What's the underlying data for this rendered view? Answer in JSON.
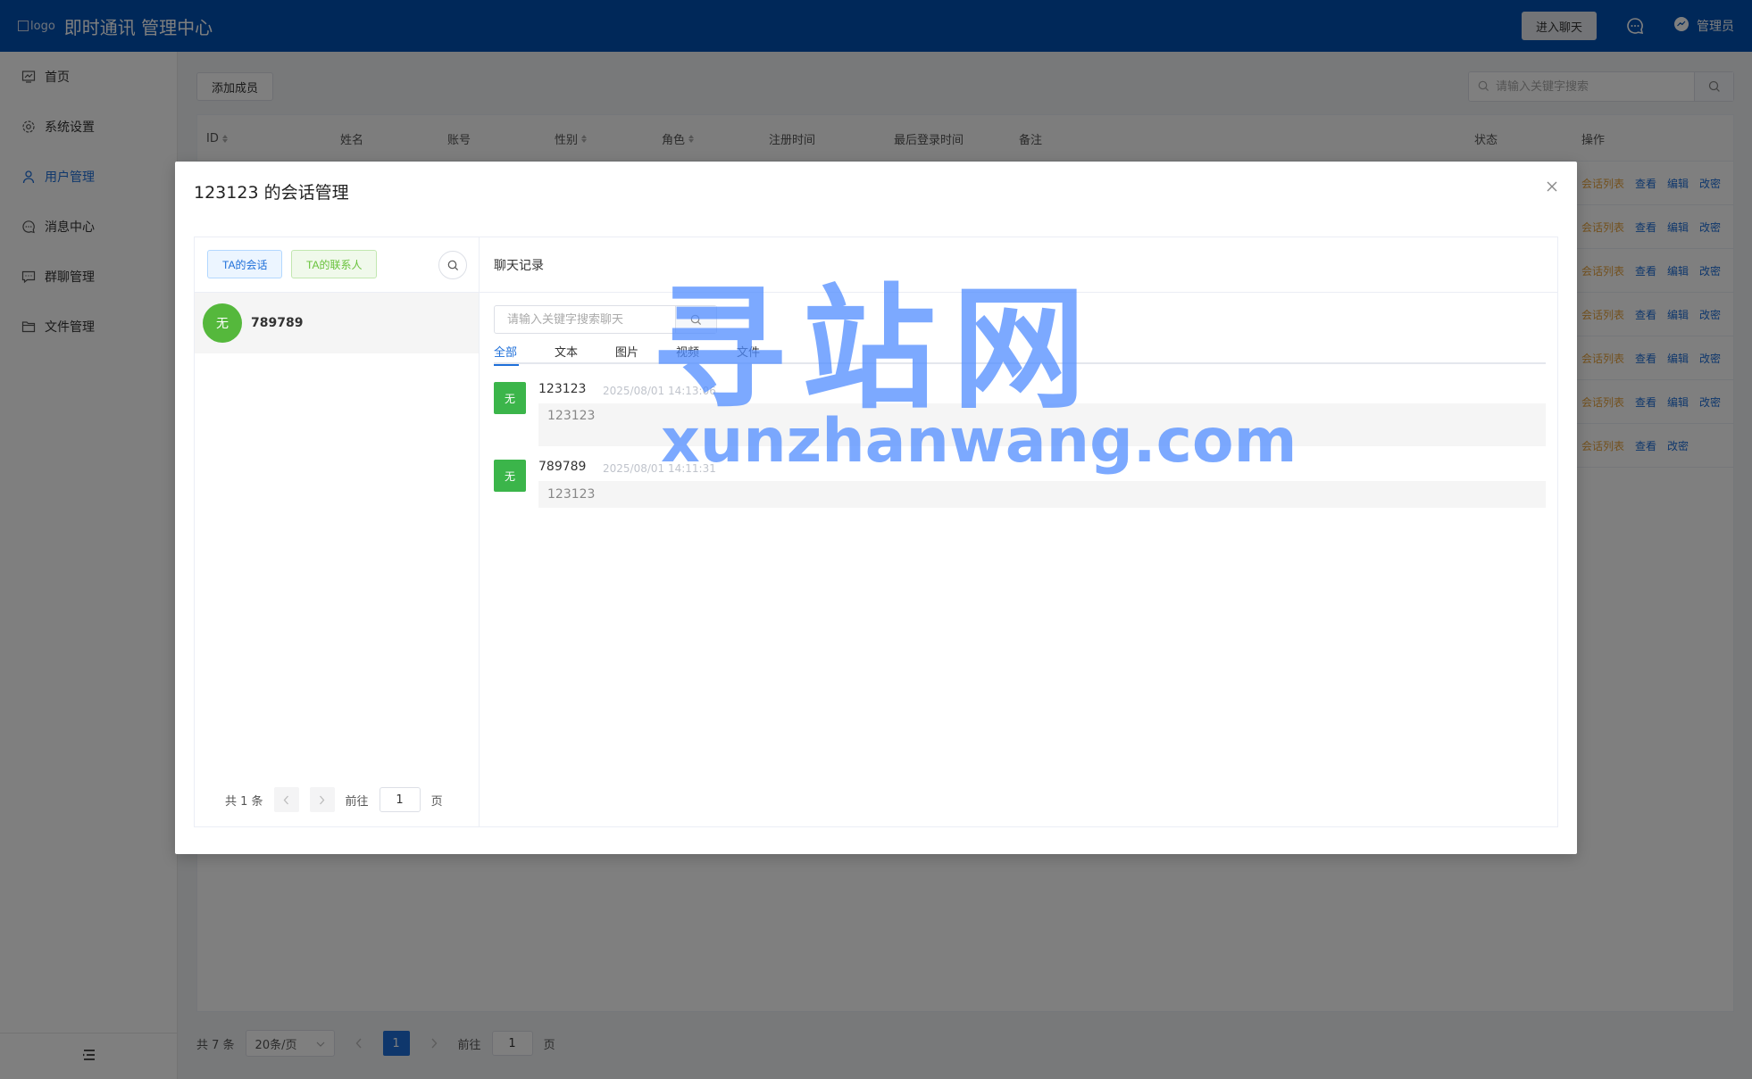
{
  "header": {
    "logo_alt": "logo",
    "title": "即时通讯 管理中心",
    "enter_chat": "进入聊天",
    "admin": "管理员"
  },
  "sidebar": {
    "items": [
      {
        "label": "首页",
        "icon": "chart-icon"
      },
      {
        "label": "系统设置",
        "icon": "gear-icon"
      },
      {
        "label": "用户管理",
        "icon": "user-icon"
      },
      {
        "label": "消息中心",
        "icon": "chat-bubble-icon"
      },
      {
        "label": "群聊管理",
        "icon": "group-chat-icon"
      },
      {
        "label": "文件管理",
        "icon": "folder-icon"
      }
    ],
    "active": "用户管理"
  },
  "toolbar": {
    "add_member": "添加成员",
    "search_placeholder": "请输入关键字搜索"
  },
  "table": {
    "columns": [
      "ID",
      "姓名",
      "账号",
      "性别",
      "角色",
      "注册时间",
      "最后登录时间",
      "备注",
      "状态",
      "操作"
    ],
    "rows_ops": [
      [
        "会话列表",
        "查看",
        "编辑",
        "改密"
      ],
      [
        "会话列表",
        "查看",
        "编辑",
        "改密"
      ],
      [
        "会话列表",
        "查看",
        "编辑",
        "改密"
      ],
      [
        "会话列表",
        "查看",
        "编辑",
        "改密"
      ],
      [
        "会话列表",
        "查看",
        "编辑",
        "改密"
      ],
      [
        "会话列表",
        "查看",
        "编辑",
        "改密"
      ],
      [
        "会话列表",
        "查看",
        "改密"
      ]
    ]
  },
  "pagination": {
    "total": "共 7 条",
    "page_size": "20条/页",
    "current": "1",
    "goto_prefix": "前往",
    "goto_value": "1",
    "goto_suffix": "页"
  },
  "modal": {
    "title": "123123 的会话管理",
    "tab_conversations": "TA的会话",
    "tab_contacts": "TA的联系人",
    "conversation": {
      "avatar_text": "无",
      "name": "789789"
    },
    "left_pager": {
      "total": "共 1 条",
      "goto_prefix": "前往",
      "goto_value": "1",
      "goto_suffix": "页"
    },
    "chat_header": "聊天记录",
    "chat_search_placeholder": "请输入关键字搜索聊天",
    "filters": [
      "全部",
      "文本",
      "图片",
      "视频",
      "文件"
    ],
    "active_filter": "全部",
    "messages": [
      {
        "avatar_text": "无",
        "name": "123123",
        "time": "2025/08/01 14:13:06",
        "content": "123123"
      },
      {
        "avatar_text": "无",
        "name": "789789",
        "time": "2025/08/01 14:11:31",
        "content": "123123"
      }
    ]
  },
  "watermark": {
    "cn": "寻站网",
    "en": "xunzhanwang.com"
  },
  "colors": {
    "header_bg": "#0050b3",
    "primary": "#1e6fd9",
    "warning": "#e6a23c",
    "success": "#67c23a",
    "avatar_green": "#3bb54a"
  }
}
